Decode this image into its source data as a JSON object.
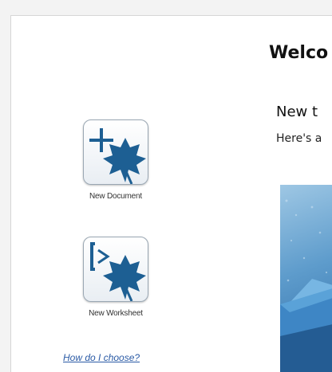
{
  "sidebar": {
    "new_document": {
      "label": "New Document",
      "icon": "new-document-icon"
    },
    "new_worksheet": {
      "label": "New Worksheet",
      "icon": "new-worksheet-icon"
    },
    "choose_link": "How do I choose?"
  },
  "main": {
    "welcome_title": "Welco",
    "whats_new_title": "New t",
    "whats_new_subtitle": "Here's a"
  },
  "colors": {
    "accent": "#1d5f93",
    "link": "#2a5aa5"
  }
}
